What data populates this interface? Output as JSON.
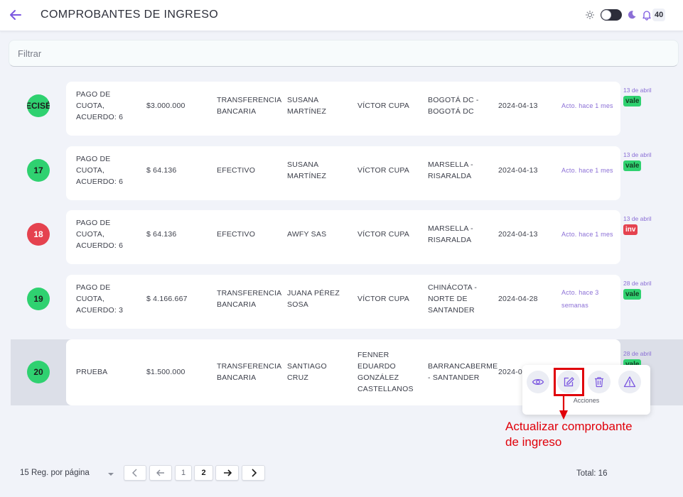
{
  "header": {
    "title": "COMPROBANTES DE INGRESO",
    "notification_count": "40"
  },
  "filter": {
    "placeholder": "Filtrar"
  },
  "rows": [
    {
      "number": "ECISÉ",
      "color": "#2fd170",
      "concept": [
        "PAGO DE",
        "CUOTA,",
        "ACUERDO: 6"
      ],
      "amount": "$3.000.000",
      "method": [
        "TRANSFERENCIA",
        "BANCARIA"
      ],
      "client": [
        "SUSANA",
        "MARTÍNEZ"
      ],
      "user": [
        "VÍCTOR CUPA"
      ],
      "city": [
        "BOGOTÁ DC -",
        "BOGOTÁ DC"
      ],
      "date": "2024-04-13",
      "updated": [
        "Acto. hace 1 mes"
      ],
      "side_date": "13 de abril",
      "badge": "vale"
    },
    {
      "number": "17",
      "color": "#2fd170",
      "concept": [
        "PAGO DE",
        "CUOTA,",
        "ACUERDO: 6"
      ],
      "amount": "$ 64.136",
      "method": [
        "EFECTIVO"
      ],
      "client": [
        "SUSANA",
        "MARTÍNEZ"
      ],
      "user": [
        "VÍCTOR CUPA"
      ],
      "city": [
        "MARSELLA -",
        "RISARALDA"
      ],
      "date": "2024-04-13",
      "updated": [
        "Acto. hace 1 mes"
      ],
      "side_date": "13 de abril",
      "badge": "vale"
    },
    {
      "number": "18",
      "color": "#e5424f",
      "concept": [
        "PAGO DE",
        "CUOTA,",
        "ACUERDO: 6"
      ],
      "amount": "$ 64.136",
      "method": [
        "EFECTIVO"
      ],
      "client": [
        "AWFY SAS"
      ],
      "user": [
        "VÍCTOR CUPA"
      ],
      "city": [
        "MARSELLA -",
        "RISARALDA"
      ],
      "date": "2024-04-13",
      "updated": [
        "Acto. hace 1 mes"
      ],
      "side_date": "13 de abril",
      "badge": "inv"
    },
    {
      "number": "19",
      "color": "#2fd170",
      "concept": [
        "PAGO DE",
        "CUOTA,",
        "ACUERDO: 3"
      ],
      "amount": "$ 4.166.667",
      "method": [
        "TRANSFERENCIA",
        "BANCARIA"
      ],
      "client": [
        "JUANA PÉREZ",
        "SOSA"
      ],
      "user": [
        "VÍCTOR CUPA"
      ],
      "city": [
        "CHINÁCOTA -",
        "NORTE DE",
        "SANTANDER"
      ],
      "date": "2024-04-28",
      "updated": [
        "Acto. hace 3",
        "semanas"
      ],
      "side_date": "28 de abril",
      "badge": "vale"
    },
    {
      "number": "20",
      "color": "#2fd170",
      "concept": [
        "PRUEBA"
      ],
      "amount": "$1.500.000",
      "method": [
        "TRANSFERENCIA",
        "BANCARIA"
      ],
      "client": [
        "SANTIAGO",
        "CRUZ"
      ],
      "user": [
        "FENNER",
        "EDUARDO",
        "GONZÁLEZ",
        "CASTELLANOS"
      ],
      "city": [
        "BARRANCABERME",
        "- SANTANDER"
      ],
      "date": "2024-0",
      "updated": [],
      "side_date": "28 de abril",
      "badge": "vale"
    }
  ],
  "actions": {
    "label": "Acciones",
    "buttons": [
      "eye-icon",
      "edit-icon",
      "trash-icon",
      "warning-icon"
    ]
  },
  "annotation": {
    "line1": "Actualizar comprobante",
    "line2": "de ingreso"
  },
  "pagination": {
    "per_page": "15 Reg. por página",
    "pages": [
      "1",
      "2"
    ],
    "current": "2",
    "total": "Total: 16"
  }
}
